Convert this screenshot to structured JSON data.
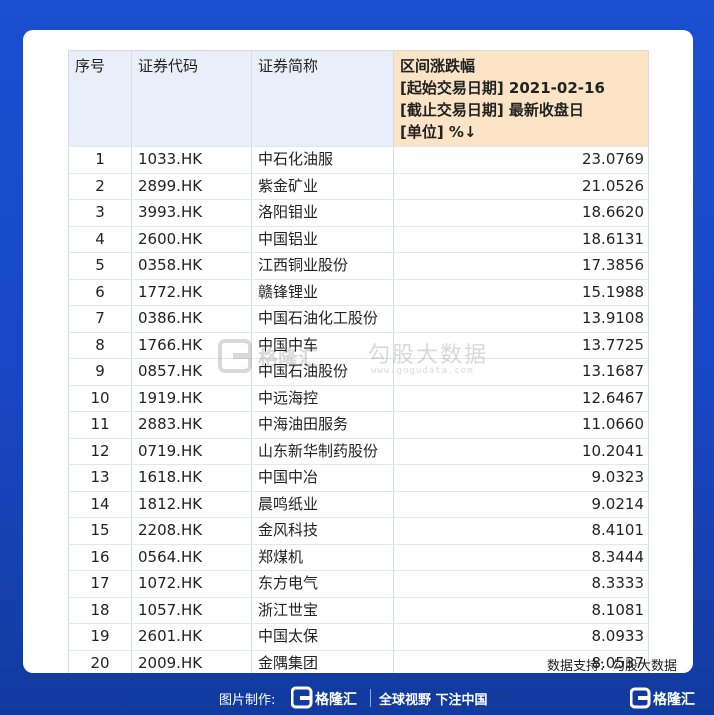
{
  "table": {
    "headers": {
      "index": "序号",
      "code": "证券代码",
      "name": "证券简称",
      "change_lines": [
        "区间涨跌幅",
        "[起始交易日期] 2021-02-16",
        "[截止交易日期] 最新收盘日",
        "[单位] %↓"
      ]
    },
    "rows": [
      {
        "idx": "1",
        "code": "1033.HK",
        "name": "中石化油服",
        "value": "23.0769"
      },
      {
        "idx": "2",
        "code": "2899.HK",
        "name": "紫金矿业",
        "value": "21.0526"
      },
      {
        "idx": "3",
        "code": "3993.HK",
        "name": "洛阳钼业",
        "value": "18.6620"
      },
      {
        "idx": "4",
        "code": "2600.HK",
        "name": "中国铝业",
        "value": "18.6131"
      },
      {
        "idx": "5",
        "code": "0358.HK",
        "name": "江西铜业股份",
        "value": "17.3856"
      },
      {
        "idx": "6",
        "code": "1772.HK",
        "name": "赣锋锂业",
        "value": "15.1988"
      },
      {
        "idx": "7",
        "code": "0386.HK",
        "name": "中国石油化工股份",
        "value": "13.9108"
      },
      {
        "idx": "8",
        "code": "1766.HK",
        "name": "中国中车",
        "value": "13.7725"
      },
      {
        "idx": "9",
        "code": "0857.HK",
        "name": "中国石油股份",
        "value": "13.1687"
      },
      {
        "idx": "10",
        "code": "1919.HK",
        "name": "中远海控",
        "value": "12.6467"
      },
      {
        "idx": "11",
        "code": "2883.HK",
        "name": "中海油田服务",
        "value": "11.0660"
      },
      {
        "idx": "12",
        "code": "0719.HK",
        "name": "山东新华制药股份",
        "value": "10.2041"
      },
      {
        "idx": "13",
        "code": "1618.HK",
        "name": "中国中冶",
        "value": "9.0323"
      },
      {
        "idx": "14",
        "code": "1812.HK",
        "name": "晨鸣纸业",
        "value": "9.0214"
      },
      {
        "idx": "15",
        "code": "2208.HK",
        "name": "金风科技",
        "value": "8.4101"
      },
      {
        "idx": "16",
        "code": "0564.HK",
        "name": "郑煤机",
        "value": "8.3444"
      },
      {
        "idx": "17",
        "code": "1072.HK",
        "name": "东方电气",
        "value": "8.3333"
      },
      {
        "idx": "18",
        "code": "1057.HK",
        "name": "浙江世宝",
        "value": "8.1081"
      },
      {
        "idx": "19",
        "code": "2601.HK",
        "name": "中国太保",
        "value": "8.0933"
      },
      {
        "idx": "20",
        "code": "2009.HK",
        "name": "金隅集团",
        "value": "8.0537"
      }
    ]
  },
  "data_source": "数据支持：勾股大数据",
  "watermark": {
    "brand": "格隆汇",
    "text": "勾股大数据",
    "url": "www.gogudata.com"
  },
  "footer": {
    "made_by_label": "图片制作:",
    "logo_text": "格隆汇",
    "slogan": "全球视野 下注中国"
  },
  "corner_logo_text": "格隆汇",
  "colors": {
    "background": "#1b4fd0",
    "header_bg": "#e9eef8",
    "highlight_header_bg": "#fbe4c6"
  }
}
